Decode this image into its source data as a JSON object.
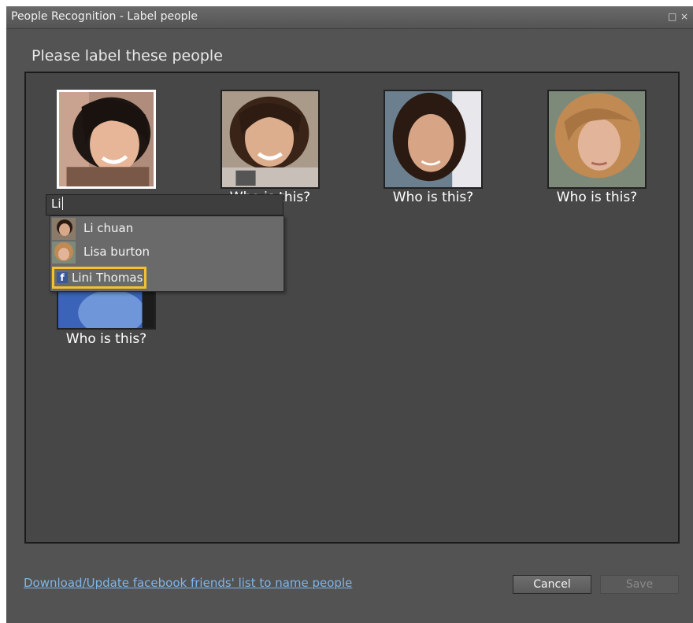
{
  "window": {
    "title": "People Recognition - Label people",
    "maximize_icon": "□",
    "close_icon": "×"
  },
  "heading": "Please label these people",
  "faces": [
    {
      "caption": "Who is this?",
      "selected": true
    },
    {
      "caption": "Who is this?"
    },
    {
      "caption": "Who is this?"
    },
    {
      "caption": "Who is this?"
    },
    {
      "caption": "Who is this?"
    }
  ],
  "name_input": {
    "value": "Li"
  },
  "suggestions": [
    {
      "label": "Li chuan",
      "icon": "person-thumbnail"
    },
    {
      "label": "Lisa burton",
      "icon": "person-thumbnail"
    },
    {
      "label": "Lini Thomas",
      "icon": "facebook-icon",
      "highlighted": true
    }
  ],
  "facebook_link": "Download/Update facebook friends' list to name people",
  "buttons": {
    "cancel": "Cancel",
    "save": "Save"
  },
  "colors": {
    "highlight": "#f2c12e",
    "link": "#7fb5e8",
    "facebook": "#3b5998"
  }
}
